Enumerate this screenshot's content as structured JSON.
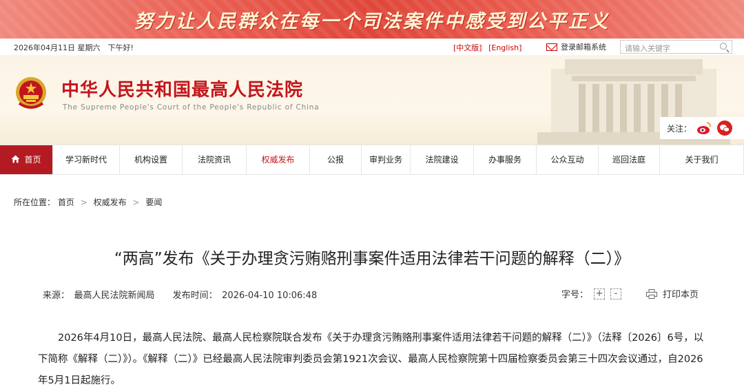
{
  "slogan": "努力让人民群众在每一个司法案件中感受到公平正义",
  "utility": {
    "date": "2026年04月11日 星期六　下午好!",
    "lang_cn": "[中文版]",
    "lang_en": "[English]",
    "mail_label": "登录邮箱系统",
    "search_placeholder": "请输入关键字"
  },
  "header": {
    "title": "中华人民共和国最高人民法院",
    "subtitle": "The Supreme People's Court of the People's Republic of China",
    "follow_label": "关注："
  },
  "nav": {
    "items": [
      {
        "label": "首页"
      },
      {
        "label": "学习新时代"
      },
      {
        "label": "机构设置"
      },
      {
        "label": "法院资讯"
      },
      {
        "label": "权威发布"
      },
      {
        "label": "公报"
      },
      {
        "label": "审判业务"
      },
      {
        "label": "法院建设"
      },
      {
        "label": "办事服务"
      },
      {
        "label": "公众互动"
      },
      {
        "label": "巡回法庭"
      },
      {
        "label": "关于我们"
      }
    ]
  },
  "breadcrumb": {
    "prefix": "所在位置：",
    "items": [
      "首页",
      "权威发布",
      "要闻"
    ],
    "separator": ">"
  },
  "article": {
    "title": "“两高”发布《关于办理贪污贿赂刑事案件适用法律若干问题的解释（二）》",
    "source": "来源：　最高人民法院新闻局",
    "published": "发布时间：　2026-04-10 10:06:48",
    "font_size_label": "字号：",
    "font_plus": "+",
    "font_minus": "-",
    "print_label": "打印本页",
    "paragraph": "2026年4月10日，最高人民法院、最高人民检察院联合发布《关于办理贪污贿赂刑事案件适用法律若干问题的解释（二）》（法释〔2026〕6号，以下简称《解释（二）》）。《解释（二）》已经最高人民法院审判委员会第1921次会议、最高人民检察院第十四届检察委员会第三十四次会议通过，自2026年5月1日起施行。"
  },
  "colors": {
    "brand_red": "#c4151c",
    "nav_active": "#b41a21",
    "header_bg": "#fbf4e6"
  },
  "icons": [
    "emblem-icon",
    "home-icon",
    "mail-icon",
    "search-icon",
    "weibo-icon",
    "wechat-icon",
    "print-icon"
  ]
}
